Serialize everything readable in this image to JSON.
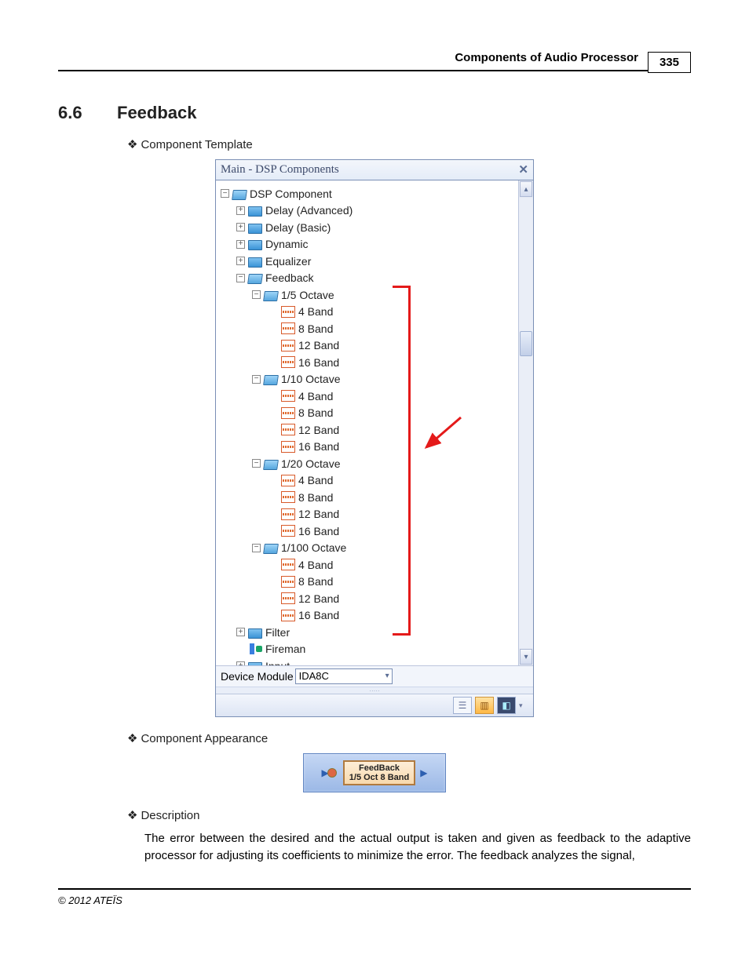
{
  "header": {
    "title": "Components of Audio Processor",
    "page_number": "335"
  },
  "section": {
    "number": "6.6",
    "title": "Feedback"
  },
  "sub_headings": {
    "template": "Component Template",
    "appearance": "Component Appearance",
    "description": "Description"
  },
  "panel": {
    "title": "Main - DSP Components",
    "device_label": "Device Module",
    "device_value": "IDA8C"
  },
  "tree": {
    "root": "DSP Component",
    "delay_adv": "Delay (Advanced)",
    "delay_basic": "Delay (Basic)",
    "dynamic": "Dynamic",
    "equalizer": "Equalizer",
    "feedback": "Feedback",
    "oct15": "1/5 Octave",
    "oct110": "1/10 Octave",
    "oct120": "1/20 Octave",
    "oct1100": "1/100 Octave",
    "band4": "4 Band",
    "band8": "8 Band",
    "band12": "12 Band",
    "band16": "16 Band",
    "filter": "Filter",
    "fireman": "Fireman",
    "input": "Input"
  },
  "component_box": {
    "line1": "FeedBack",
    "line2": "1/5 Oct 8 Band"
  },
  "description_text": "The error between the desired and the actual output is taken and given as feedback to the adaptive processor for adjusting its coefficients to minimize the error. The feedback analyzes the signal,",
  "footer": "© 2012 ATEÏS"
}
